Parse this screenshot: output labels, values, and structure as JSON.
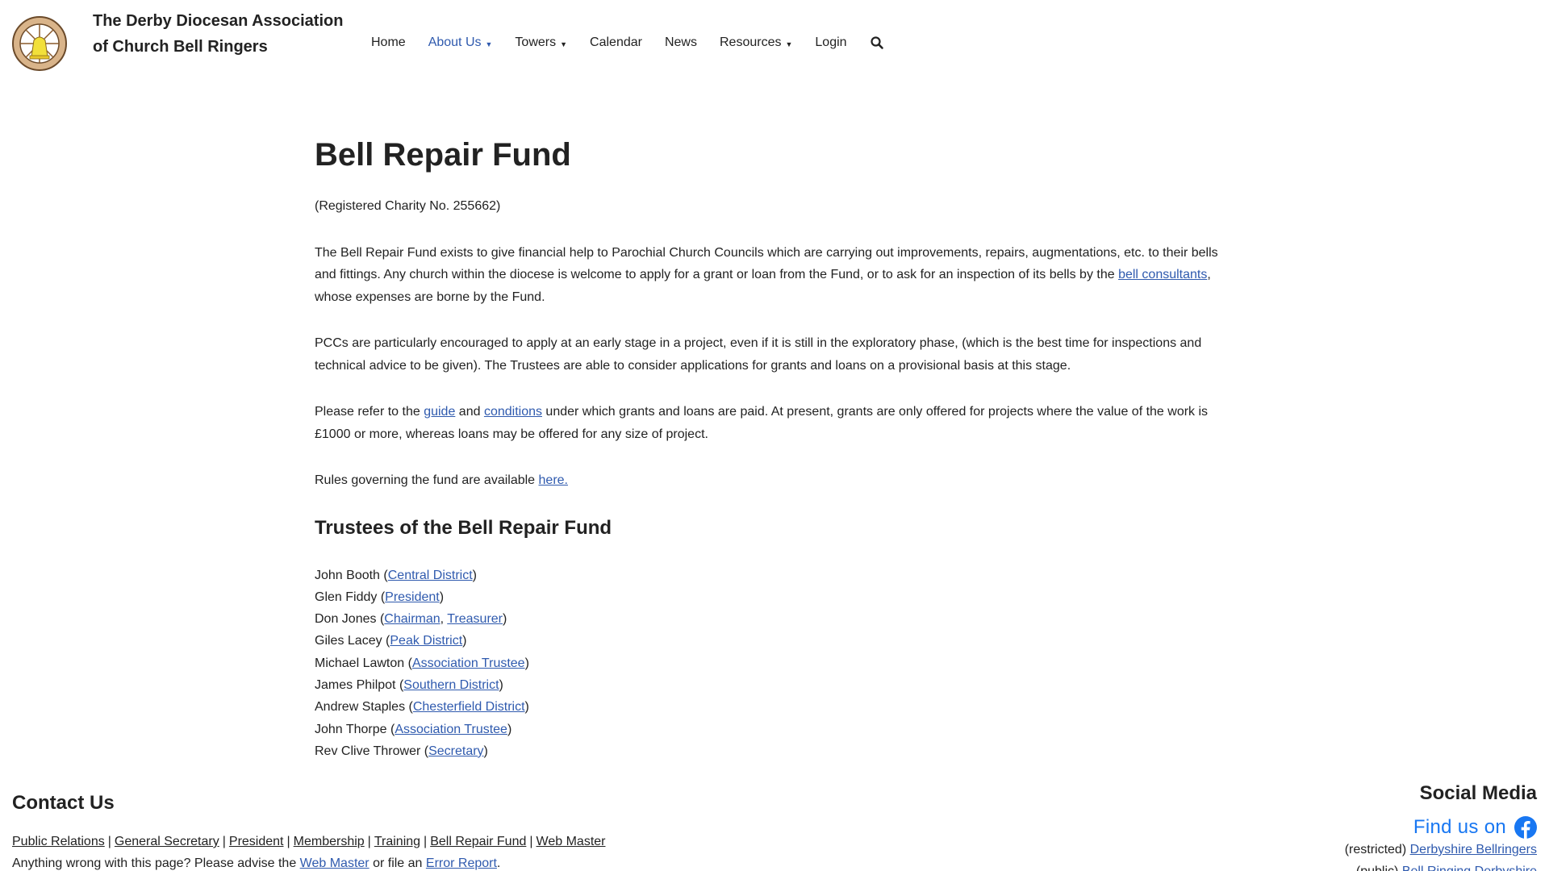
{
  "header": {
    "title_line1": "The Derby Diocesan Association",
    "title_line2": "of Church Bell Ringers"
  },
  "nav": {
    "home": "Home",
    "about": "About Us",
    "towers": "Towers",
    "calendar": "Calendar",
    "news": "News",
    "resources": "Resources",
    "login": "Login"
  },
  "page": {
    "title": "Bell Repair Fund",
    "charity": "(Registered Charity No. 255662)",
    "p1_a": "The Bell Repair Fund exists to give financial help to Parochial Church Councils which are carrying out improvements, repairs, augmentations, etc. to their bells and fittings. Any church within the diocese is welcome to apply for a grant or loan from the Fund, or to ask for an inspection of its bells by the ",
    "p1_link": "bell consultants",
    "p1_b": ", whose expenses are borne by the Fund.",
    "p2": "PCCs are particularly encouraged to apply at an early stage in a project, even if it is still in the exploratory phase, (which is the best time for inspections and technical advice to be given). The Trustees are able to consider applications for grants and loans on a provisional basis at this stage.",
    "p3_a": "Please refer to the ",
    "p3_link1": "guide",
    "p3_b": " and ",
    "p3_link2": "conditions",
    "p3_c": " under which grants and loans are paid. At present, grants are only offered for projects where the value of the work is £1000 or more, whereas loans may be offered for any size of project.",
    "p4_a": "Rules governing the fund are available ",
    "p4_link": "here.",
    "trustees_title": "Trustees of the Bell Repair Fund",
    "trustees": [
      {
        "name": "John Booth",
        "roles": [
          "Central District"
        ]
      },
      {
        "name": "Glen Fiddy",
        "roles": [
          "President"
        ]
      },
      {
        "name": "Don Jones",
        "roles": [
          "Chairman",
          "Treasurer"
        ]
      },
      {
        "name": "Giles Lacey",
        "roles": [
          "Peak District"
        ]
      },
      {
        "name": "Michael Lawton",
        "roles": [
          "Association Trustee"
        ]
      },
      {
        "name": "James Philpot",
        "roles": [
          "Southern District"
        ]
      },
      {
        "name": "Andrew Staples",
        "roles": [
          "Chesterfield District"
        ]
      },
      {
        "name": "John Thorpe",
        "roles": [
          "Association Trustee"
        ]
      },
      {
        "name": "Rev Clive Thrower",
        "roles": [
          "Secretary"
        ]
      }
    ]
  },
  "footer": {
    "contact_title": "Contact Us",
    "contact_links": [
      "Public Relations",
      "General Secretary",
      "President",
      "Membership",
      "Training",
      "Bell Repair Fund",
      "Web Master"
    ],
    "report_a": "Anything wrong with this page? Please advise the ",
    "report_link1": "Web Master",
    "report_b": " or file an ",
    "report_link2": "Error Report",
    "report_c": ".",
    "social_title": "Social Media",
    "fb_text": "Find us on",
    "social_line1_prefix": "(restricted) ",
    "social_line1_link": "Derbyshire Bellringers",
    "social_line2_prefix": "(public) ",
    "social_line2_link": "Bell Ringing Derbyshire"
  },
  "colors": {
    "link": "#2f5aae",
    "facebook": "#1877f2",
    "text": "#222222",
    "logo_bell": "#f2e03a"
  },
  "icons": {
    "logo": "association-logo-bell",
    "search": "search-icon",
    "facebook": "facebook-icon",
    "caret": "caret-down-icon"
  }
}
